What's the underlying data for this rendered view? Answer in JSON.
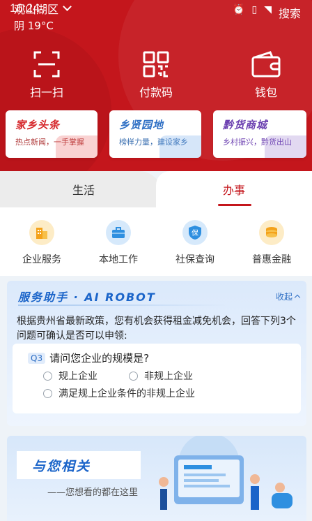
{
  "status": {
    "time": "16:24"
  },
  "header": {
    "location": "观山湖区",
    "weather": "阴 19°C",
    "search_label": "搜索"
  },
  "quick_actions": [
    {
      "label": "扫一扫",
      "icon": "scan-icon"
    },
    {
      "label": "付款码",
      "icon": "qr-code-icon"
    },
    {
      "label": "钱包",
      "icon": "wallet-icon"
    }
  ],
  "feature_cards": [
    {
      "title": "家乡头条",
      "subtitle": "热点新闻，一手掌握",
      "color": "#d6272b"
    },
    {
      "title": "乡贤园地",
      "subtitle": "榜样力量，建设家乡",
      "color": "#2e6fc4"
    },
    {
      "title": "黔货商城",
      "subtitle": "乡村振兴，黔货出山",
      "color": "#6b3fb0"
    }
  ],
  "tabs": {
    "life": "生活",
    "affairs": "办事",
    "active": "affairs"
  },
  "services": [
    {
      "label": "企业服务",
      "icon": "building-icon",
      "color": "#f4a21a"
    },
    {
      "label": "本地工作",
      "icon": "briefcase-icon",
      "color": "#2e8fe0"
    },
    {
      "label": "社保查询",
      "icon": "shield-icon",
      "glyph": "保",
      "color": "#2e8fe0"
    },
    {
      "label": "普惠金融",
      "icon": "coins-icon",
      "color": "#f4a21a"
    }
  ],
  "assistant": {
    "title": "服务助手 · AI ROBOT",
    "collapse_label": "收起",
    "intro": "根据贵州省最新政策，您有机会获得租金减免机会，回答下列3个问题可确认是否可以申领:",
    "question_tag": "Q3",
    "question": "请问您企业的规模是?",
    "options": [
      "规上企业",
      "非规上企业",
      "满足规上企业条件的非规上企业"
    ]
  },
  "related": {
    "title": "与您相关",
    "subtitle": "——您想看的都在这里"
  },
  "colors": {
    "brand_red": "#c4161c",
    "accent_blue": "#1a64c9"
  }
}
